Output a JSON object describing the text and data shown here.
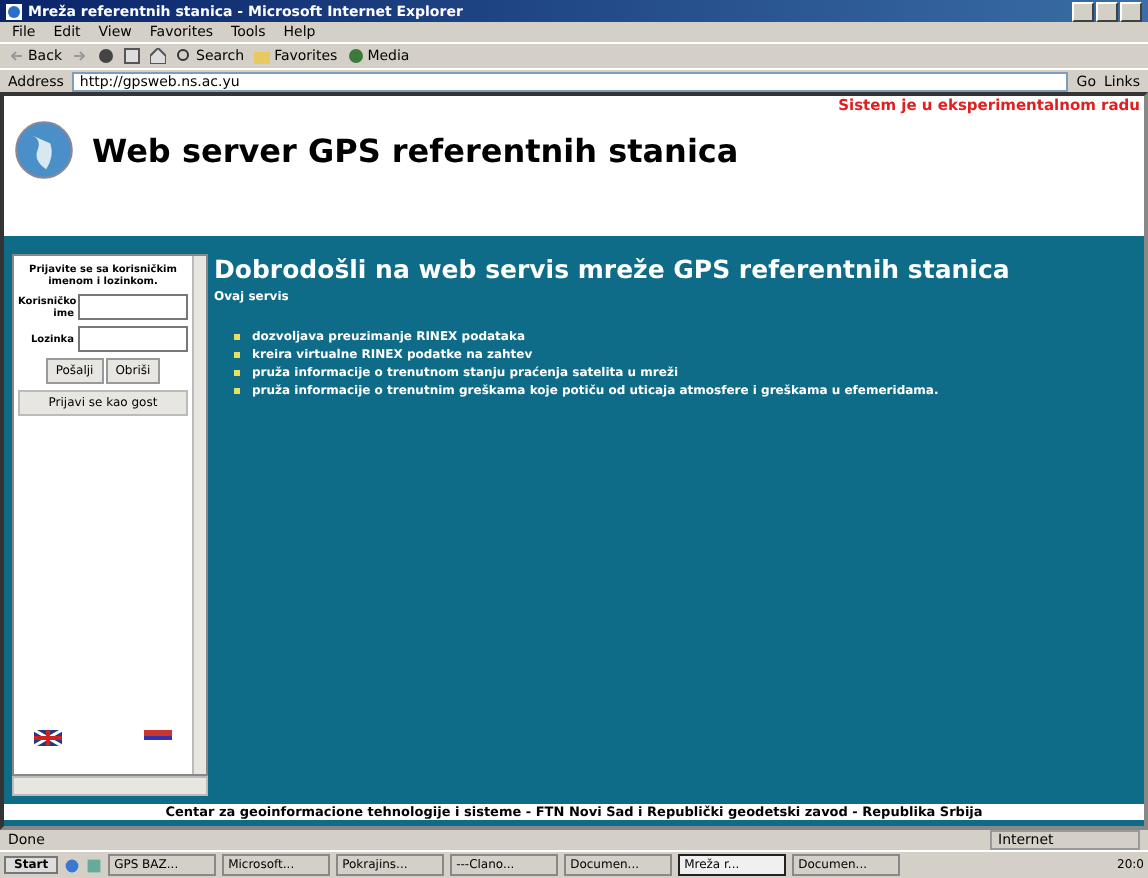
{
  "window": {
    "title": "Mreža referentnih stanica - Microsoft Internet Explorer"
  },
  "menu": [
    "File",
    "Edit",
    "View",
    "Favorites",
    "Tools",
    "Help"
  ],
  "toolbar": [
    {
      "kind": "back",
      "label": "Back"
    },
    {
      "kind": "forward"
    },
    {
      "kind": "stop"
    },
    {
      "kind": "refresh"
    },
    {
      "kind": "home"
    },
    {
      "kind": "search",
      "label": "Search"
    },
    {
      "kind": "favorites",
      "label": "Favorites"
    },
    {
      "kind": "media",
      "label": "Media"
    }
  ],
  "address": {
    "label": "Address",
    "value": "http://gpsweb.ns.ac.yu",
    "go": "Go",
    "links": "Links"
  },
  "page": {
    "notice": "Sistem je u eksperimentalnom radu",
    "heading": "Web server GPS referentnih stanica",
    "login": {
      "intro": "Prijavite se sa korisničkim imenom i lozinkom.",
      "user_label": "Korisničko ime",
      "password_label": "Lozinka",
      "buttons": [
        "Pošalji",
        "Obriši"
      ],
      "guest": "Prijavi se kao gost"
    },
    "welcome": "Dobrodošli na web servis mreže GPS referentnih stanica",
    "subtitle": "Ovaj servis",
    "features": [
      "dozvoljava preuzimanje RINEX podataka",
      "kreira virtualne RINEX podatke na zahtev",
      "pruža informacije o trenutnom stanju praćenja satelita u mreži",
      "pruža informacije o trenutnim greškama koje potiču od uticaja atmosfere i greškama u efemeridama."
    ],
    "footer": "Centar za geoinformacione tehnologije i sisteme - FTN Novi Sad i Republički geodetski zavod - Republika Srbija"
  },
  "status_bar": {
    "text": "Done",
    "zone": "Internet"
  },
  "taskbar": {
    "start": "Start",
    "tasks": [
      {
        "label": "GPS BAZ...",
        "selected": false
      },
      {
        "label": "Microsoft...",
        "selected": false
      },
      {
        "label": "Pokrajins...",
        "selected": false
      },
      {
        "label": "---Clano...",
        "selected": false
      },
      {
        "label": "Documen...",
        "selected": false
      },
      {
        "label": "Mreža r...",
        "selected": true
      },
      {
        "label": "Documen...",
        "selected": false
      }
    ],
    "clock": "20:0"
  }
}
